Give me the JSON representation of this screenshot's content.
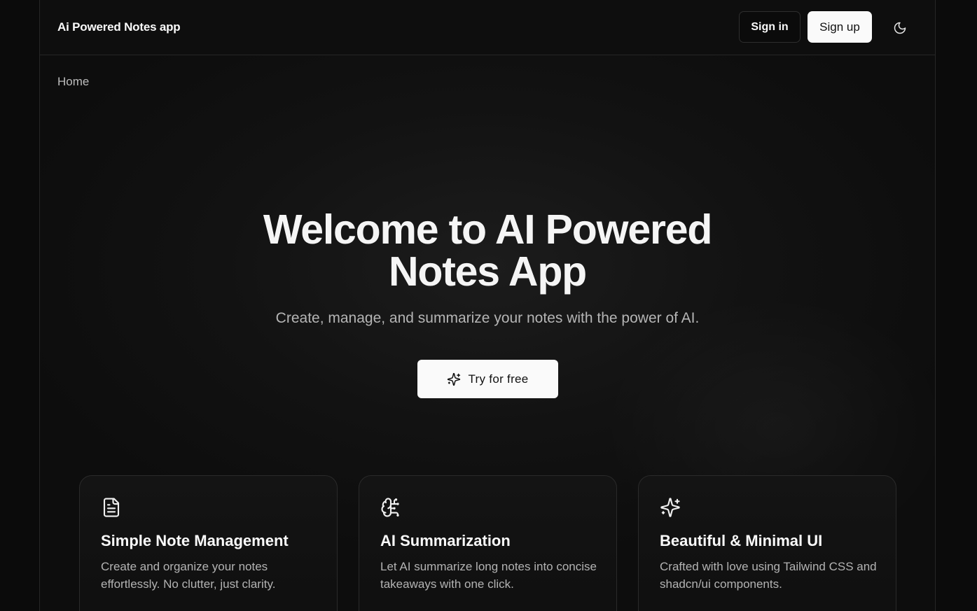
{
  "header": {
    "brand": "Ai Powered Notes app",
    "sign_in": "Sign in",
    "sign_up": "Sign up",
    "theme_icon": "moon-icon"
  },
  "breadcrumb": "Home",
  "hero": {
    "title_line1": "Welcome to AI Powered",
    "title_line2": "Notes App",
    "subtitle": "Create, manage, and summarize your notes with the power of AI.",
    "cta_label": "Try for free",
    "cta_icon": "sparkles-icon"
  },
  "features": [
    {
      "icon": "file-text-icon",
      "title": "Simple Note Management",
      "desc": "Create and organize your notes effortlessly. No clutter, just clarity."
    },
    {
      "icon": "brain-icon",
      "title": "AI Summarization",
      "desc": "Let AI summarize long notes into concise takeaways with one click."
    },
    {
      "icon": "sparkles-icon",
      "title": "Beautiful & Minimal UI",
      "desc": "Crafted with love using Tailwind CSS and shadcn/ui components."
    }
  ],
  "colors": {
    "background": "#0b0b0b",
    "border": "#262626",
    "primary_button": "#fafafa",
    "muted_text": "#b3b3b3"
  }
}
